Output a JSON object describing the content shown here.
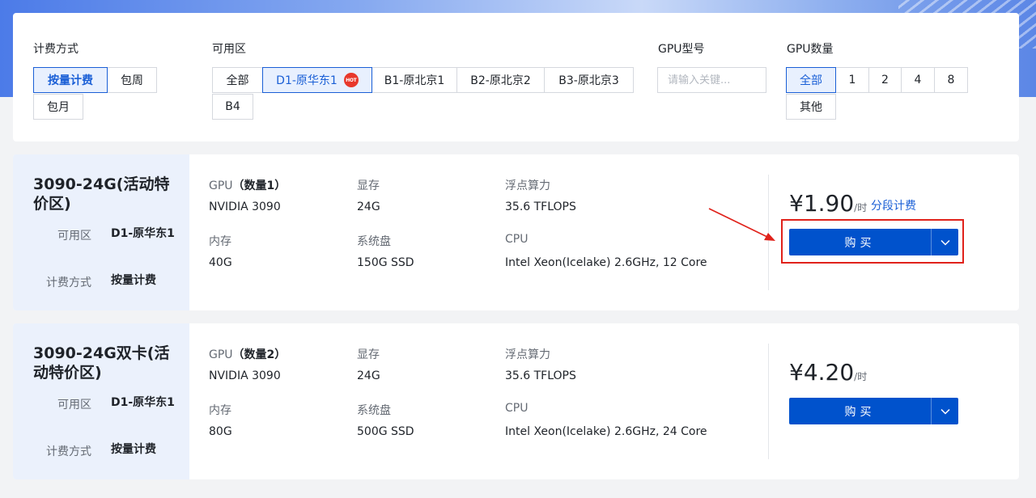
{
  "filters": {
    "billing": {
      "label": "计费方式",
      "options": [
        "按量计费",
        "包周",
        "包月"
      ]
    },
    "zone": {
      "label": "可用区",
      "options": [
        "全部",
        "D1-原华东1",
        "B1-原北京1",
        "B2-原北京2",
        "B3-原北京3",
        "B4"
      ],
      "hot_badge": "HOT"
    },
    "gpu_model": {
      "label": "GPU型号",
      "placeholder": "请输入关键..."
    },
    "gpu_count": {
      "label": "GPU数量",
      "options": [
        "全部",
        "1",
        "2",
        "4",
        "8",
        "其他"
      ]
    }
  },
  "products": [
    {
      "name": "3090-24G(活动特价区)",
      "zone_label": "可用区",
      "zone_value": "D1-原华东1",
      "billing_label": "计费方式",
      "billing_value": "按量计费",
      "gpu_label": "GPU",
      "gpu_count": "（数量1）",
      "gpu_value": "NVIDIA 3090",
      "vram_label": "显存",
      "vram_value": "24G",
      "flops_label": "浮点算力",
      "flops_value": "35.6 TFLOPS",
      "mem_label": "内存",
      "mem_value": "40G",
      "disk_label": "系统盘",
      "disk_value": "150G SSD",
      "cpu_label": "CPU",
      "cpu_value": "Intel Xeon(Icelake) 2.6GHz, 12 Core",
      "price": "¥1.90",
      "price_unit": "/时",
      "seg_link": "分段计费",
      "buy_label": "购买"
    },
    {
      "name": "3090-24G双卡(活动特价区)",
      "zone_label": "可用区",
      "zone_value": "D1-原华东1",
      "billing_label": "计费方式",
      "billing_value": "按量计费",
      "gpu_label": "GPU",
      "gpu_count": "（数量2）",
      "gpu_value": "NVIDIA 3090",
      "vram_label": "显存",
      "vram_value": "24G",
      "flops_label": "浮点算力",
      "flops_value": "35.6 TFLOPS",
      "mem_label": "内存",
      "mem_value": "80G",
      "disk_label": "系统盘",
      "disk_value": "500G SSD",
      "cpu_label": "CPU",
      "cpu_value": "Intel Xeon(Icelake) 2.6GHz, 24 Core",
      "price": "¥4.20",
      "price_unit": "/时",
      "buy_label": "购买"
    }
  ],
  "colors": {
    "accent": "#0052cc",
    "annotation": "#e0221b",
    "hot": "#e8382b"
  }
}
